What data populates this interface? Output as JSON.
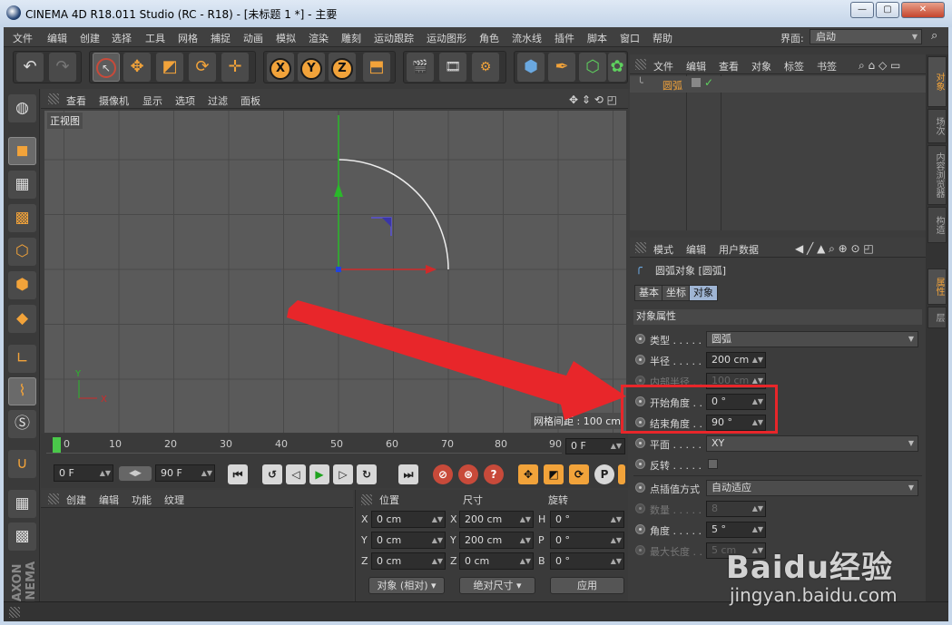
{
  "window": {
    "title": "CINEMA 4D R18.011 Studio (RC - R18) - [未标题 1 *] - 主要",
    "minimize": "—",
    "maximize": "▢",
    "close": "✕"
  },
  "menubar": {
    "items": [
      "文件",
      "编辑",
      "创建",
      "选择",
      "工具",
      "网格",
      "捕捉",
      "动画",
      "模拟",
      "渲染",
      "雕刻",
      "运动跟踪",
      "运动图形",
      "角色",
      "流水线",
      "插件",
      "脚本",
      "窗口",
      "帮助"
    ],
    "layout_label": "界面:",
    "layout_value": "启动"
  },
  "toolbar": {
    "axis_x": "X",
    "axis_y": "Y",
    "axis_z": "Z"
  },
  "viewport": {
    "menus": [
      "查看",
      "摄像机",
      "显示",
      "选项",
      "过滤",
      "面板"
    ],
    "view_name": "正视图",
    "grid_spacing": "网格间距 : 100 cm",
    "axis_x": "X",
    "axis_y": "Y",
    "arc_radius_cm": 200,
    "arc_start_deg": 0,
    "arc_end_deg": 90
  },
  "timeline": {
    "ticks": [
      "0",
      "10",
      "20",
      "30",
      "40",
      "50",
      "60",
      "70",
      "80",
      "90"
    ],
    "current_frame": "0 F"
  },
  "transport": {
    "start_frame": "0 F",
    "end_frame": "90 F"
  },
  "material": {
    "menus": [
      "创建",
      "编辑",
      "功能",
      "纹理"
    ]
  },
  "coords": {
    "headers": [
      "位置",
      "尺寸",
      "旋转"
    ],
    "rows": [
      {
        "axis": "X",
        "pos": "0 cm",
        "size_axis": "X",
        "size": "200 cm",
        "rot_axis": "H",
        "rot": "0 °"
      },
      {
        "axis": "Y",
        "pos": "0 cm",
        "size_axis": "Y",
        "size": "200 cm",
        "rot_axis": "P",
        "rot": "0 °"
      },
      {
        "axis": "Z",
        "pos": "0 cm",
        "size_axis": "Z",
        "size": "0 cm",
        "rot_axis": "B",
        "rot": "0 °"
      }
    ],
    "mode_object": "对象 (相对)",
    "mode_size": "绝对尺寸",
    "apply": "应用"
  },
  "object_manager": {
    "menus": [
      "文件",
      "编辑",
      "查看",
      "对象",
      "标签",
      "书签"
    ],
    "object_name": "圆弧"
  },
  "attribute_manager": {
    "menus": [
      "模式",
      "编辑",
      "用户数据"
    ],
    "object_title": "圆弧对象 [圆弧]",
    "tabs": [
      "基本",
      "坐标",
      "对象"
    ],
    "section": "对象属性",
    "type_label": "类型 . . . . .",
    "type_value": "圆弧",
    "radius_label": "半径 . . . . .",
    "radius_value": "200 cm",
    "inner_radius_label": "内部半径 . .",
    "inner_radius_value": "100 cm",
    "start_angle_label": "开始角度 . .",
    "start_angle_value": "0 °",
    "end_angle_label": "结束角度 . .",
    "end_angle_value": "90 °",
    "plane_label": "平面 . . . . .",
    "plane_value": "XY",
    "reverse_label": "反转 . . . . .",
    "interp_label": "点插值方式",
    "interp_value": "自动适应",
    "count_label": "数量 . . . . .",
    "count_value": "8",
    "angle_label": "角度 . . . . .",
    "angle_value": "5 °",
    "maxlen_label": "最大长度 . .",
    "maxlen_value": "5 cm"
  },
  "right_tabs": {
    "top": [
      "对象",
      "场次",
      "内容浏览器",
      "构造"
    ],
    "bottom": [
      "属性",
      "层"
    ]
  },
  "watermark": {
    "main": "Baidu经验",
    "url": "jingyan.baidu.com"
  },
  "colors": {
    "accent": "#f2a33a",
    "highlight": "#e8262a",
    "axis_x": "#d02a2a",
    "axis_y": "#2ab82a"
  }
}
